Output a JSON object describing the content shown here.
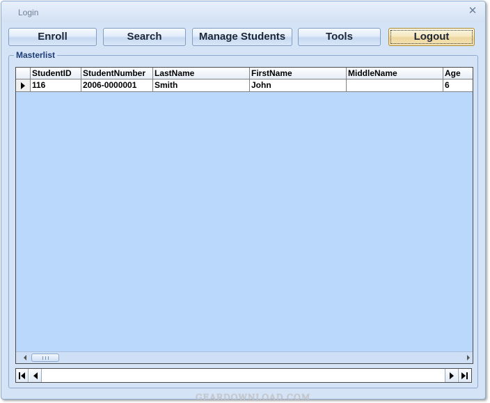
{
  "window": {
    "title": "Login"
  },
  "toolbar": {
    "enroll_label": "Enroll",
    "search_label": "Search",
    "manage_students_label": "Manage Students",
    "tools_label": "Tools",
    "logout_label": "Logout"
  },
  "masterlist": {
    "label": "Masterlist",
    "columns": [
      "StudentID",
      "StudentNumber",
      "LastName",
      "FirstName",
      "MiddleName",
      "Age"
    ],
    "rows": [
      [
        "116",
        "2006-0000001",
        "Smith",
        "John",
        "",
        "6"
      ]
    ]
  },
  "watermark": "GEARDOWNLOAD.COM",
  "colors": {
    "window_background": "#d5e3f6",
    "grid_background": "#bad8fb",
    "group_label": "#1b3c76",
    "focused_button": "#f6e8bf"
  }
}
